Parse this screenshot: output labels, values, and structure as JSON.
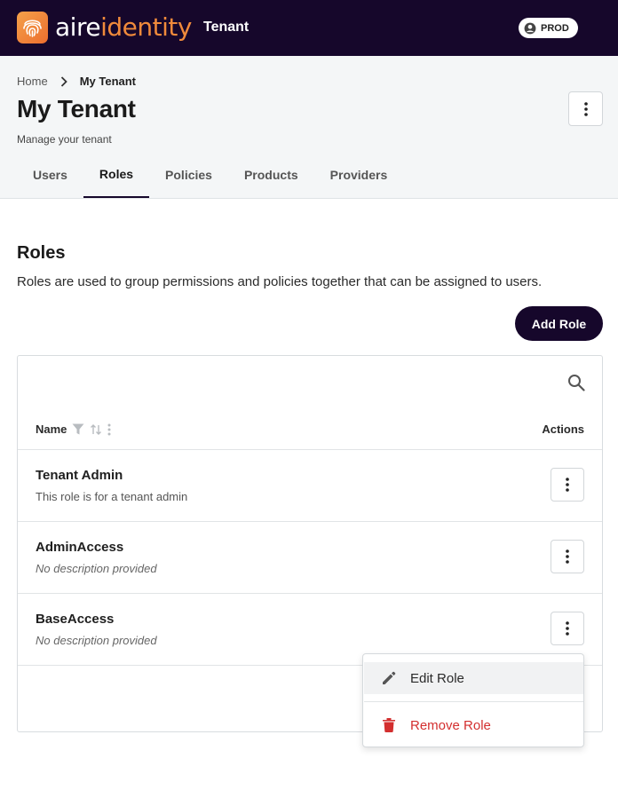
{
  "topbar": {
    "logo_part1": "aire",
    "logo_part2": "identity",
    "app_name": "Tenant",
    "environment": "PROD"
  },
  "breadcrumb": {
    "home": "Home",
    "current": "My Tenant"
  },
  "page": {
    "title": "My Tenant",
    "subtitle": "Manage your tenant"
  },
  "tabs": [
    {
      "label": "Users",
      "active": false
    },
    {
      "label": "Roles",
      "active": true
    },
    {
      "label": "Policies",
      "active": false
    },
    {
      "label": "Products",
      "active": false
    },
    {
      "label": "Providers",
      "active": false
    }
  ],
  "roles_section": {
    "title": "Roles",
    "description": "Roles are used to group permissions and policies together that can be assigned to users.",
    "add_button": "Add Role"
  },
  "table": {
    "columns": {
      "name": "Name",
      "actions": "Actions"
    },
    "rows": [
      {
        "name": "Tenant Admin",
        "description": "This role is for a tenant admin"
      },
      {
        "name": "AdminAccess",
        "description": "No description provided"
      },
      {
        "name": "BaseAccess",
        "description": "No description provided"
      }
    ]
  },
  "row_menu": {
    "edit": "Edit Role",
    "remove": "Remove Role"
  },
  "colors": {
    "brand_dark": "#16072b",
    "brand_orange": "#f08a3b",
    "danger": "#d32f2f"
  }
}
